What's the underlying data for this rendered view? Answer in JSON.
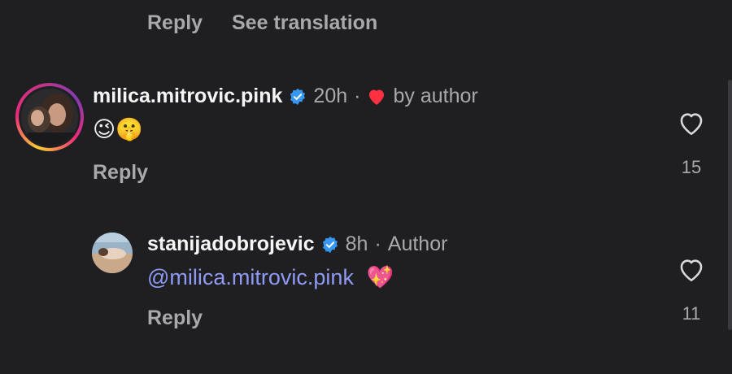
{
  "top": {
    "reply_label": "Reply",
    "translate_label": "See translation"
  },
  "comments": [
    {
      "username": "milica.mitrovic.pink",
      "time": "20h",
      "liked_by": "by author",
      "text": "😉🤫",
      "reply_label": "Reply",
      "likes": "15"
    },
    {
      "username": "stanijadobrojevic",
      "time": "8h",
      "role": "Author",
      "mention": "@milica.mitrovic.pink",
      "emoji": "💖",
      "reply_label": "Reply",
      "likes": "11"
    }
  ],
  "icons": {
    "verified": "verified-badge-icon",
    "heart_filled": "heart-filled-icon",
    "like": "heart-outline-icon"
  },
  "colors": {
    "background": "#1f1f22",
    "verified": "#3897f0",
    "heart": "#ff3040",
    "mention": "#8f9af5",
    "muted": "#a8a8ad"
  }
}
